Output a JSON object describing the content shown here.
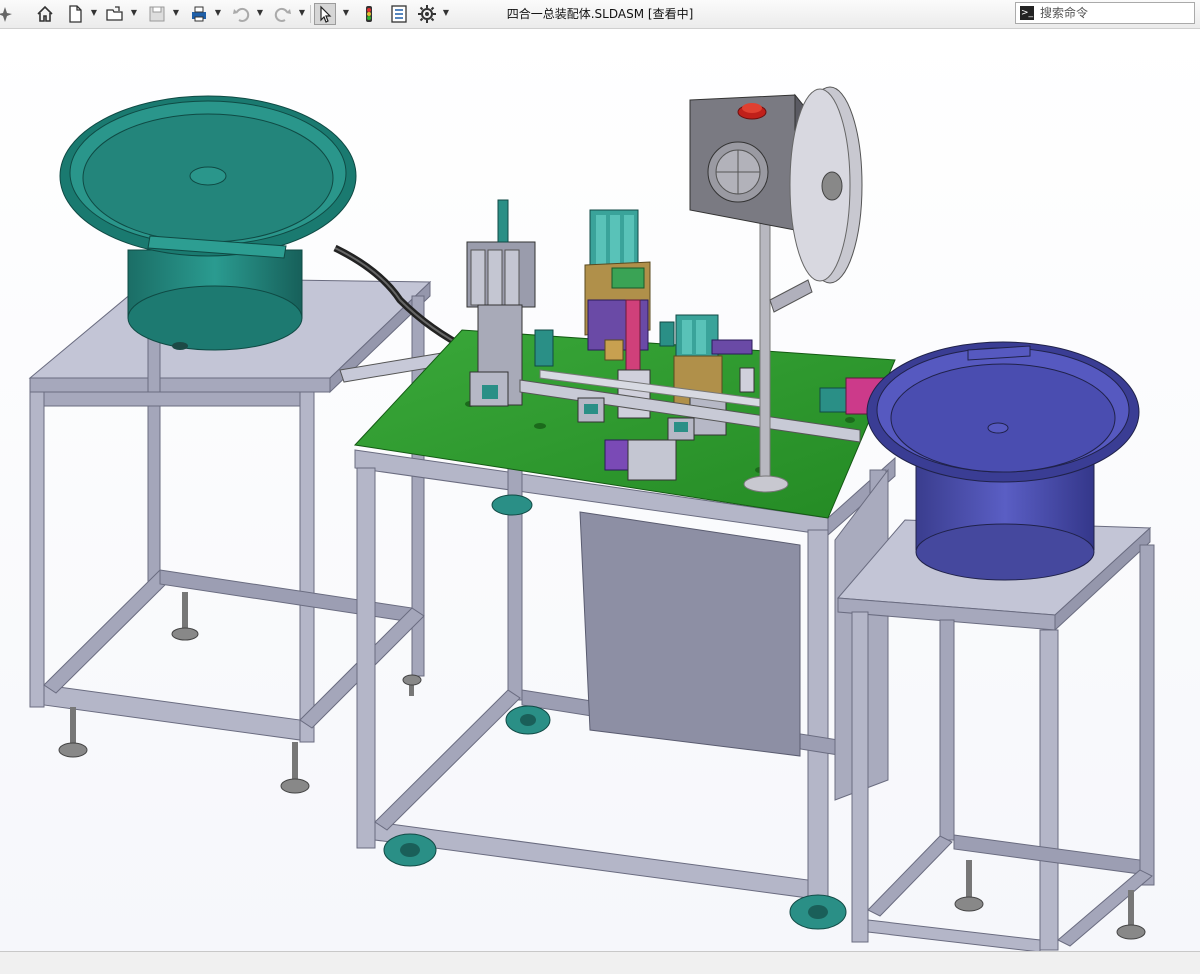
{
  "app": {
    "document_title": "四合一总装配体.SLDASM [查看中]"
  },
  "toolbar": {
    "icons": [
      "pin-icon",
      "home-icon",
      "new-document-icon",
      "open-file-icon",
      "save-icon",
      "print-icon",
      "undo-icon",
      "redo-icon",
      "select-pointer-icon",
      "rebuild-icon",
      "file-properties-icon",
      "options-gear-icon"
    ]
  },
  "search": {
    "placeholder": "搜索命令"
  },
  "view_toolbar": {
    "icons": [
      "zoom-to-fit-icon",
      "zoom-to-area-icon",
      "previous-view-icon",
      "section-view-icon",
      "view-orientation-icon",
      "display-style-icon",
      "hide-show-items-icon",
      "edit-appearance-icon",
      "apply-scene-icon",
      "view-settings-icon"
    ]
  },
  "colors": {
    "frame": "#b4b6c8",
    "frame_dark": "#8a8ca3",
    "green_plate": "#2f9a2f",
    "teal_bowl": "#1f8a80",
    "blue_bowl": "#4b4fb0",
    "caster": "#2a8f86"
  },
  "status": {
    "left_text": "",
    "right_text": ""
  }
}
